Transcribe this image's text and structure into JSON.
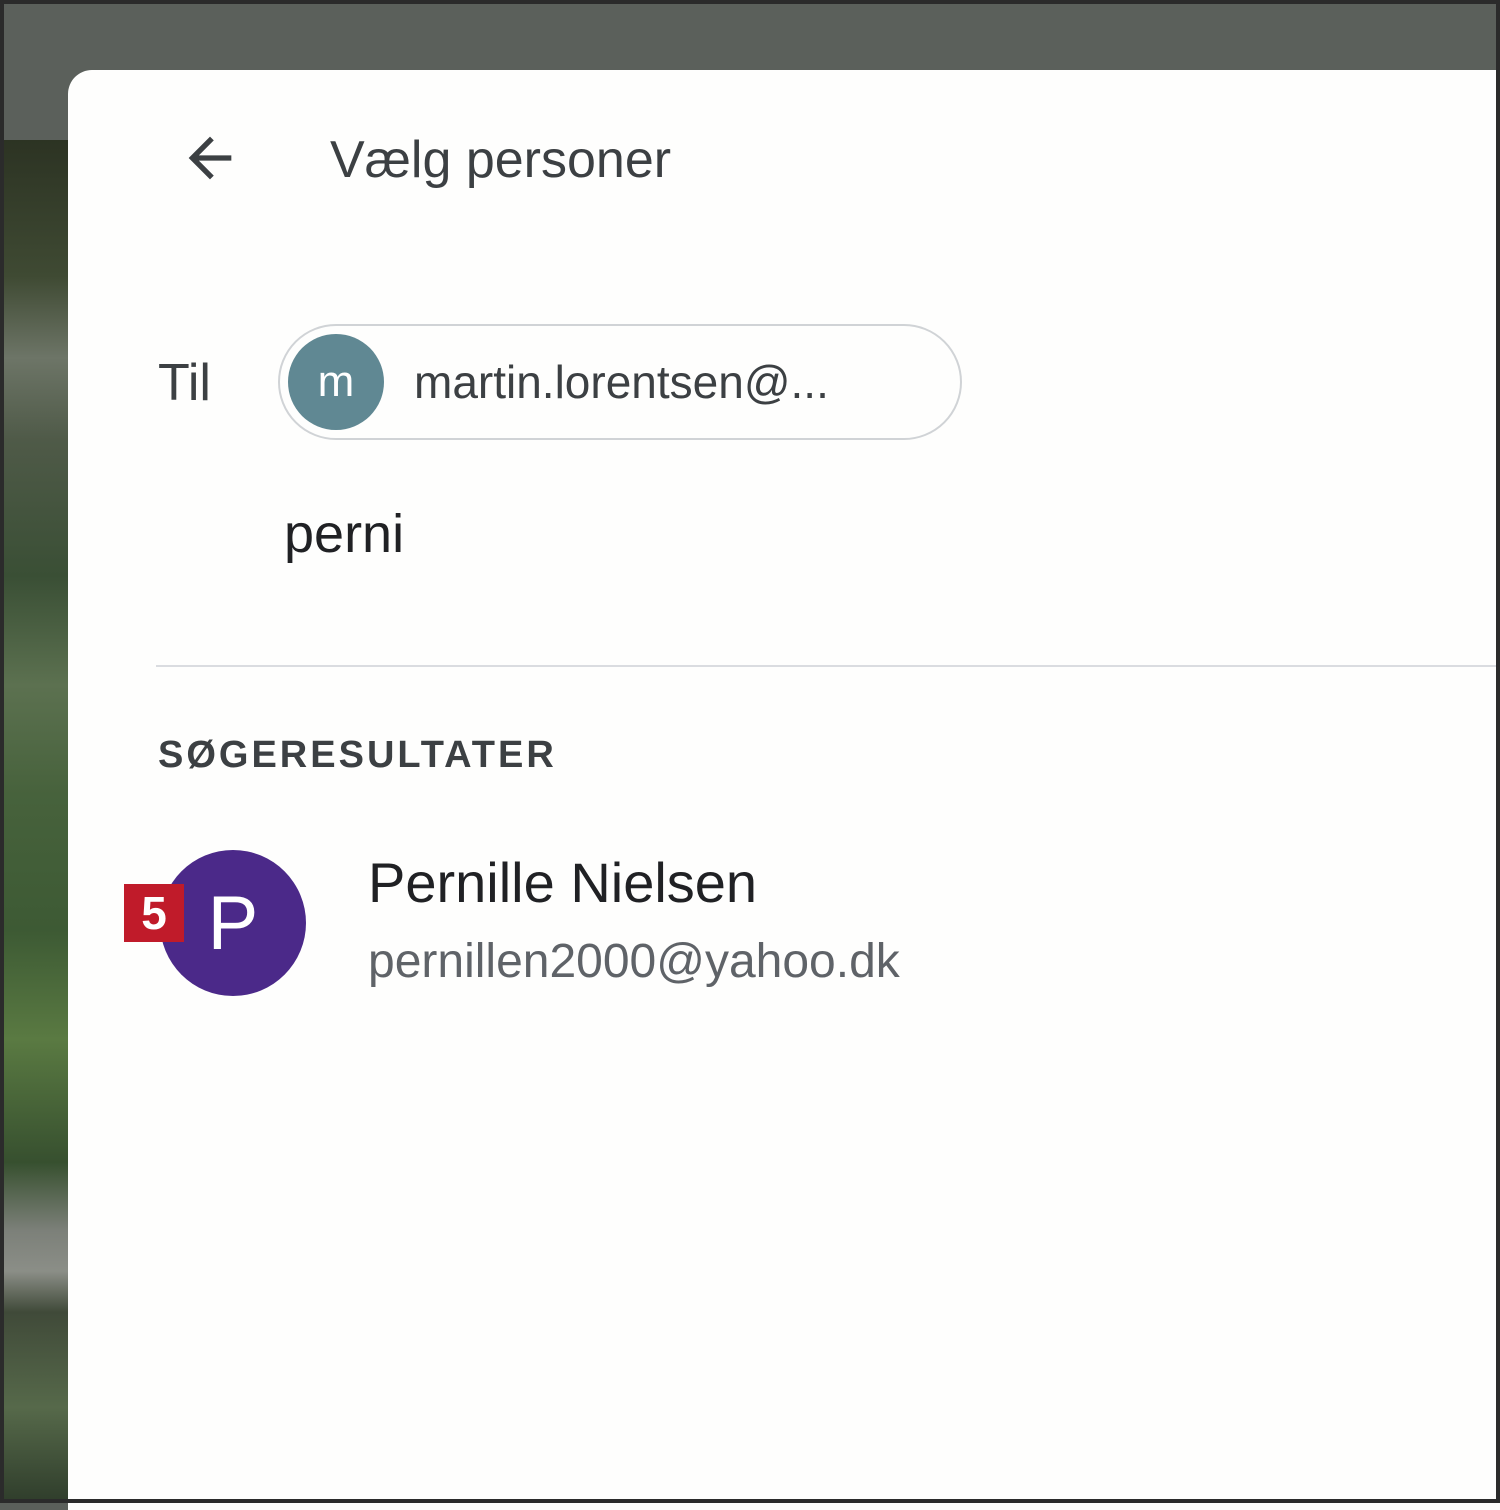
{
  "header": {
    "title": "Vælg personer"
  },
  "recipients": {
    "to_label": "Til",
    "chips": [
      {
        "initial": "m",
        "label": "martin.lorentsen@...",
        "color": "#608893"
      }
    ]
  },
  "search": {
    "value": "perni"
  },
  "results": {
    "section_label": "SØGERESULTATER",
    "items": [
      {
        "initial": "P",
        "name": "Pernille Nielsen",
        "email": "pernillen2000@yahoo.dk",
        "color": "#4b2989"
      }
    ]
  },
  "annotation": {
    "step_number": "5",
    "color": "#c01b2a"
  }
}
